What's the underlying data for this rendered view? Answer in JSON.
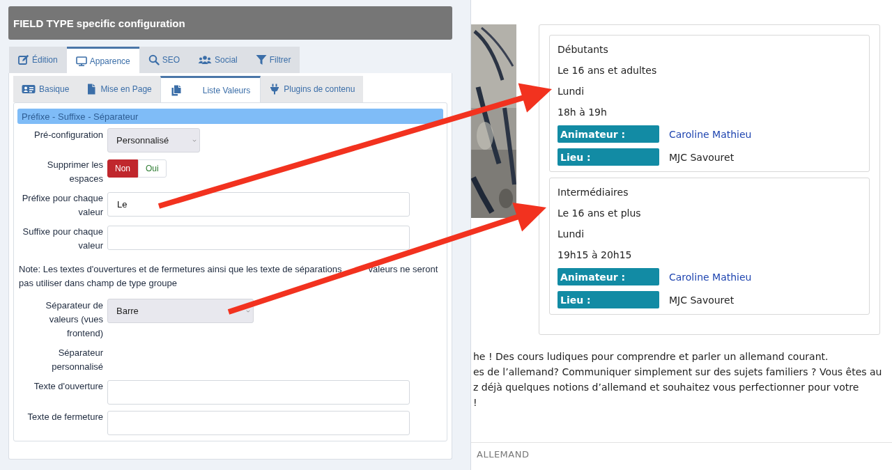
{
  "panel": {
    "title": "FIELD TYPE specific configuration",
    "tabs": [
      {
        "label": "Édition",
        "selected": false
      },
      {
        "label": "Apparence",
        "selected": true
      },
      {
        "label": "SEO",
        "selected": false
      },
      {
        "label": "Social",
        "selected": false
      },
      {
        "label": "Filtrer",
        "selected": false
      }
    ],
    "subtabs": [
      {
        "label": "Basique",
        "selected": false
      },
      {
        "label": "Mise en Page",
        "selected": false
      },
      {
        "label": "Liste Valeurs",
        "selected": true
      },
      {
        "label": "Plugins de contenu",
        "selected": false
      }
    ],
    "section_title": "Préfixe - Suffixe - Séparateur",
    "rows": [
      {
        "kind": "select",
        "label": "Pré-configuration",
        "value": "Personnalisé"
      },
      {
        "kind": "toggle",
        "label": "Supprimer les espaces",
        "options": [
          {
            "label": "Non",
            "selected": true
          },
          {
            "label": "Oui",
            "selected": false
          }
        ]
      },
      {
        "kind": "input",
        "label": "Préfixe pour chaque valeur",
        "value": "Le"
      },
      {
        "kind": "input",
        "label": "Suffixe pour chaque valeur"
      },
      {
        "kind": "note",
        "parts": [
          "Note: Les textes d'ouvertures et de fermetures ainsi que les texte de séparations",
          "valeurs ne seront",
          "pas utiliser dans champ de type groupe"
        ]
      },
      {
        "kind": "select",
        "label": "Séparateur de valeurs (vues frontend)",
        "value": "Barre"
      },
      {
        "kind": "empty",
        "label": "Séparateur personnalisé"
      },
      {
        "kind": "input",
        "label": "Texte d'ouverture"
      },
      {
        "kind": "input",
        "label": "Texte de fermeture"
      }
    ]
  },
  "page": {
    "picture": {
      "kind": "picture"
    },
    "courses": [
      {
        "title": "Débutants",
        "lines": [
          "Le 16 ans et adultes",
          "Lundi",
          "18h à 19h"
        ],
        "fields": [
          {
            "label": "Animateur :",
            "value": "Caroline Mathieu",
            "link": true
          },
          {
            "label": "Lieu :",
            "value": "MJC Savouret",
            "link": false
          }
        ]
      },
      {
        "title": "Intermédiaires",
        "lines": [
          "Le 16 ans et plus",
          "Lundi",
          "19h15 à 20h15"
        ],
        "fields": [
          {
            "label": "Animateur :",
            "value": "Caroline Mathieu",
            "link": true
          },
          {
            "label": "Lieu :",
            "value": "MJC Savouret",
            "link": false
          }
        ]
      }
    ],
    "paragraph_lines": [
      "he ! Des cours ludiques pour comprendre et parler un allemand courant.",
      "es de l’allemand? Communiquer simplement sur des sujets familiers ? Vous êtes au",
      "z déjà quelques notions d’allemand et souhaitez vous perfectionner pour votre",
      "!"
    ],
    "breadcrumb": "ALLEMAND"
  }
}
